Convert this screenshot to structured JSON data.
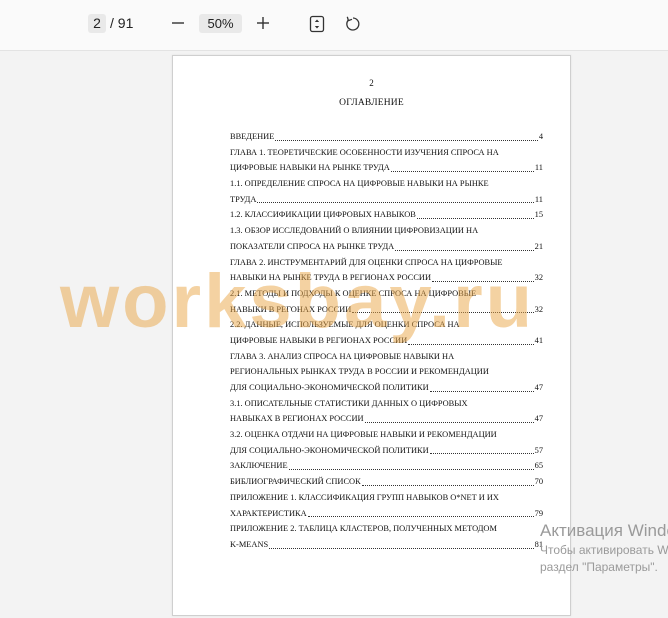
{
  "toolbar": {
    "current_page": "2",
    "page_total": "/ 91",
    "zoom_out_icon": "minus-icon",
    "zoom_level": "50%",
    "zoom_in_icon": "plus-icon",
    "fit_icon": "fit-page-icon",
    "rotate_icon": "rotate-icon"
  },
  "document": {
    "page_number": "2",
    "title": "ОГЛАВЛЕНИЕ",
    "toc": [
      {
        "text": "ВВЕДЕНИЕ",
        "page": "4"
      },
      {
        "text": "ГЛАВА 1. ТЕОРЕТИЧЕСКИЕ ОСОБЕННОСТИ ИЗУЧЕНИЯ СПРОСА НА"
      },
      {
        "text": "ЦИФРОВЫЕ НАВЫКИ НА РЫНКЕ ТРУДА",
        "page": "11"
      },
      {
        "text": "1.1. ОПРЕДЕЛЕНИЕ СПРОСА НА ЦИФРОВЫЕ НАВЫКИ НА РЫНКЕ"
      },
      {
        "text": "ТРУДА",
        "page": "11"
      },
      {
        "text": "1.2. КЛАССИФИКАЦИИ ЦИФРОВЫХ НАВЫКОВ",
        "page": "15"
      },
      {
        "text": "1.3. ОБЗОР ИССЛЕДОВАНИЙ О ВЛИЯНИИ ЦИФРОВИЗАЦИИ НА"
      },
      {
        "text": "ПОКАЗАТЕЛИ СПРОСА НА РЫНКЕ ТРУДА",
        "page": "21"
      },
      {
        "text": "ГЛАВА 2. ИНСТРУМЕНТАРИЙ ДЛЯ ОЦЕНКИ СПРОСА НА ЦИФРОВЫЕ"
      },
      {
        "text": "НАВЫКИ НА РЫНКЕ ТРУДА В РЕГИОНАХ РОССИИ",
        "page": "32"
      },
      {
        "text": "2.1. МЕТОДЫ И ПОДХОДЫ К ОЦЕНКЕ СПРОСА НА ЦИФРОВЫЕ"
      },
      {
        "text": "НАВЫКИ В РЕГОНАХ РОССИИ",
        "page": "32"
      },
      {
        "text": "2.2. ДАННЫЕ, ИСПОЛЬЗУЕМЫЕ ДЛЯ ОЦЕНКИ СПРОСА НА"
      },
      {
        "text": "ЦИФРОВЫЕ НАВЫКИ В РЕГИОНАХ РОССИИ",
        "page": "41"
      },
      {
        "text": "ГЛАВА 3. АНАЛИЗ СПРОСА НА ЦИФРОВЫЕ НАВЫКИ НА"
      },
      {
        "text": "РЕГИОНАЛЬНЫХ РЫНКАХ ТРУДА В РОССИИ И РЕКОМЕНДАЦИИ"
      },
      {
        "text": "ДЛЯ СОЦИАЛЬНО-ЭКОНОМИЧЕСКОЙ ПОЛИТИКИ",
        "page": "47"
      },
      {
        "text": "3.1. ОПИСАТЕЛЬНЫЕ СТАТИСТИКИ ДАННЫХ О ЦИФРОВЫХ"
      },
      {
        "text": "НАВЫКАХ В РЕГИОНАХ РОССИИ",
        "page": "47"
      },
      {
        "text": "3.2. ОЦЕНКА ОТДАЧИ НА ЦИФРОВЫЕ НАВЫКИ И РЕКОМЕНДАЦИИ"
      },
      {
        "text": "ДЛЯ СОЦИАЛЬНО-ЭКОНОМИЧЕСКОЙ ПОЛИТИКИ",
        "page": "57"
      },
      {
        "text": "ЗАКЛЮЧЕНИЕ",
        "page": "65"
      },
      {
        "text": "БИБЛИОГРАФИЧЕСКИЙ СПИСОК",
        "page": "70"
      },
      {
        "text": "ПРИЛОЖЕНИЕ 1. КЛАССИФИКАЦИЯ ГРУПП НАВЫКОВ O*NET И ИХ"
      },
      {
        "text": "ХАРАКТЕРИСТИКА",
        "page": "79"
      },
      {
        "text": "ПРИЛОЖЕНИЕ 2. ТАБЛИЦА КЛАСТЕРОВ, ПОЛУЧЕННЫХ МЕТОДОМ"
      },
      {
        "text": "K-MEANS",
        "page": "81"
      }
    ]
  },
  "watermark": "worksbay.ru",
  "activation": {
    "title": "Активация Windows",
    "line1": "Чтобы активировать Windows, перейдите в",
    "line2": "раздел \"Параметры\"."
  }
}
